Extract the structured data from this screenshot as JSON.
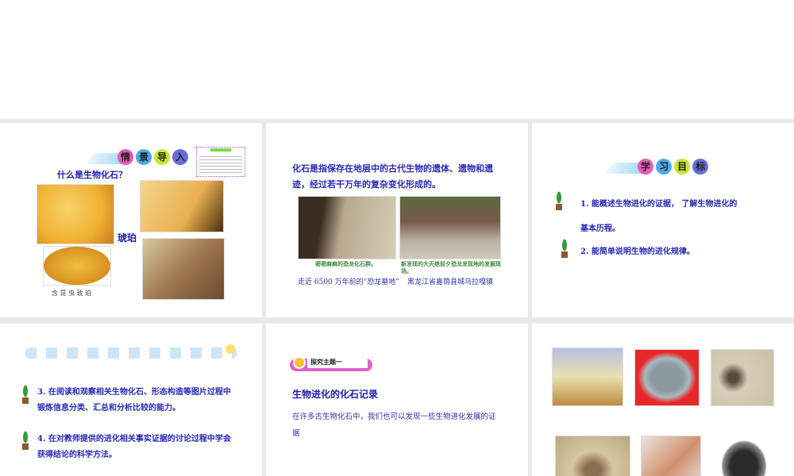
{
  "slides": [
    {
      "heading_chars": [
        "情",
        "景",
        "导",
        "入"
      ],
      "question": "什么是生物化石？",
      "amber_label": "琥珀",
      "caption": "含 昆 虫 琥 珀"
    },
    {
      "definition": "化石是指保存在地层中的古代生物的遗体、遗物和遗迹，经过若干万年的复杂变化形成的。",
      "photo1_caption": "密密麻麻的恐龙化石群。",
      "photo2_caption": "新发现的大灭绝前夕恐龙发现地的发掘现场。",
      "label1": "走近 6500 万年前的“恐龙墓地”",
      "label2": "黑龙江省嘉荫县城乌拉嘎镇"
    },
    {
      "heading_chars": [
        "学",
        "习",
        "目",
        "标"
      ],
      "goal1": "1. 能概述生物进化的证据， 了解生物进化的",
      "goal1b": "基本历程。",
      "goal2": "2. 能简单说明生物的进化规律。"
    },
    {
      "goal3": "3. 在阅读和观察相关生物化石、形态构造等图片过程中锻炼信息分类、汇总和分析比较的能力。",
      "goal4": "4. 在对教师提供的进化相关事实证据的讨论过程中学会获得结论的科学方法。"
    },
    {
      "tag": "探究主题一",
      "title": "生物进化的化石记录",
      "body": "在许多古生物化石中，我们也可以发现一些生物进化发展的证据"
    },
    {}
  ],
  "colors": {
    "ball1": "#e85ab8",
    "ball2": "#4fa8e8",
    "ball3": "#c8e830",
    "ball4": "#6a6ae0",
    "text": "#2828b8"
  }
}
